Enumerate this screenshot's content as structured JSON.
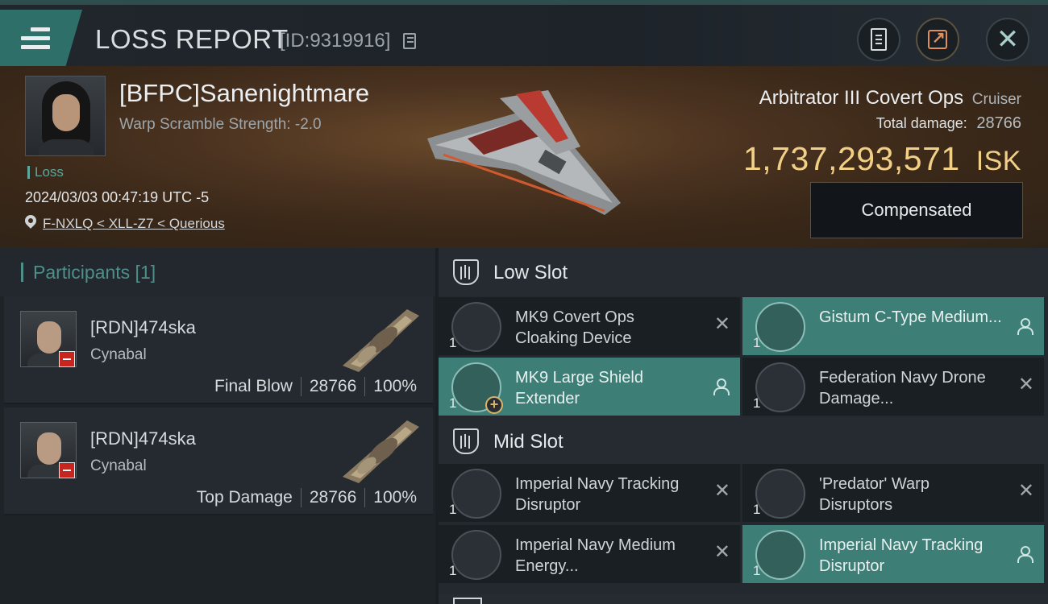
{
  "header": {
    "title": "LOSS REPORT",
    "report_id": "[ID:9319916]",
    "icons": [
      "menu-icon",
      "copy-icon",
      "clipboard-icon",
      "share-icon",
      "close-icon"
    ]
  },
  "victim": {
    "pilot_name": "[BFPC]Sanenightmare",
    "warp_scramble": "Warp Scramble Strength: -2.0",
    "status": "Loss",
    "datetime": "2024/03/03 00:47:19 UTC -5",
    "location": "F-NXLQ < XLL-Z7 < Querious",
    "ship_name": "Arbitrator III Covert Ops",
    "ship_class": "Cruiser",
    "total_damage_label": "Total damage:",
    "total_damage": "28766",
    "isk_value": "1,737,293,571",
    "isk_unit": "ISK",
    "compensated_label": "Compensated"
  },
  "participants": {
    "title": "Participants [1]",
    "rows": [
      {
        "name": "[RDN]474ska",
        "ship": "Cynabal",
        "role": "Final Blow",
        "damage": "28766",
        "percent": "100%"
      },
      {
        "name": "[RDN]474ska",
        "ship": "Cynabal",
        "role": "Top Damage",
        "damage": "28766",
        "percent": "100%"
      }
    ]
  },
  "slots": {
    "low": {
      "title": "Low Slot",
      "modules": [
        {
          "qty": "1",
          "name": "MK9 Covert Ops Cloaking Device",
          "state": "destroyed"
        },
        {
          "qty": "1",
          "name": "Gistum C-Type Medium...",
          "state": "dropped"
        },
        {
          "qty": "1",
          "name": "MK9 Large Shield Extender",
          "state": "dropped"
        },
        {
          "qty": "1",
          "name": "Federation Navy Drone Damage...",
          "state": "destroyed"
        }
      ]
    },
    "mid": {
      "title": "Mid Slot",
      "modules": [
        {
          "qty": "1",
          "name": "Imperial Navy Tracking Disruptor",
          "state": "destroyed"
        },
        {
          "qty": "1",
          "name": "'Predator' Warp Disruptors",
          "state": "destroyed"
        },
        {
          "qty": "1",
          "name": "Imperial Navy Medium Energy...",
          "state": "destroyed"
        },
        {
          "qty": "1",
          "name": "Imperial Navy Tracking Disruptor",
          "state": "dropped"
        }
      ]
    }
  },
  "colors": {
    "accent": "#3d7e77",
    "isk": "#f2cf86",
    "loss": "#5fa69e",
    "badge_negative": "#c8251e"
  }
}
